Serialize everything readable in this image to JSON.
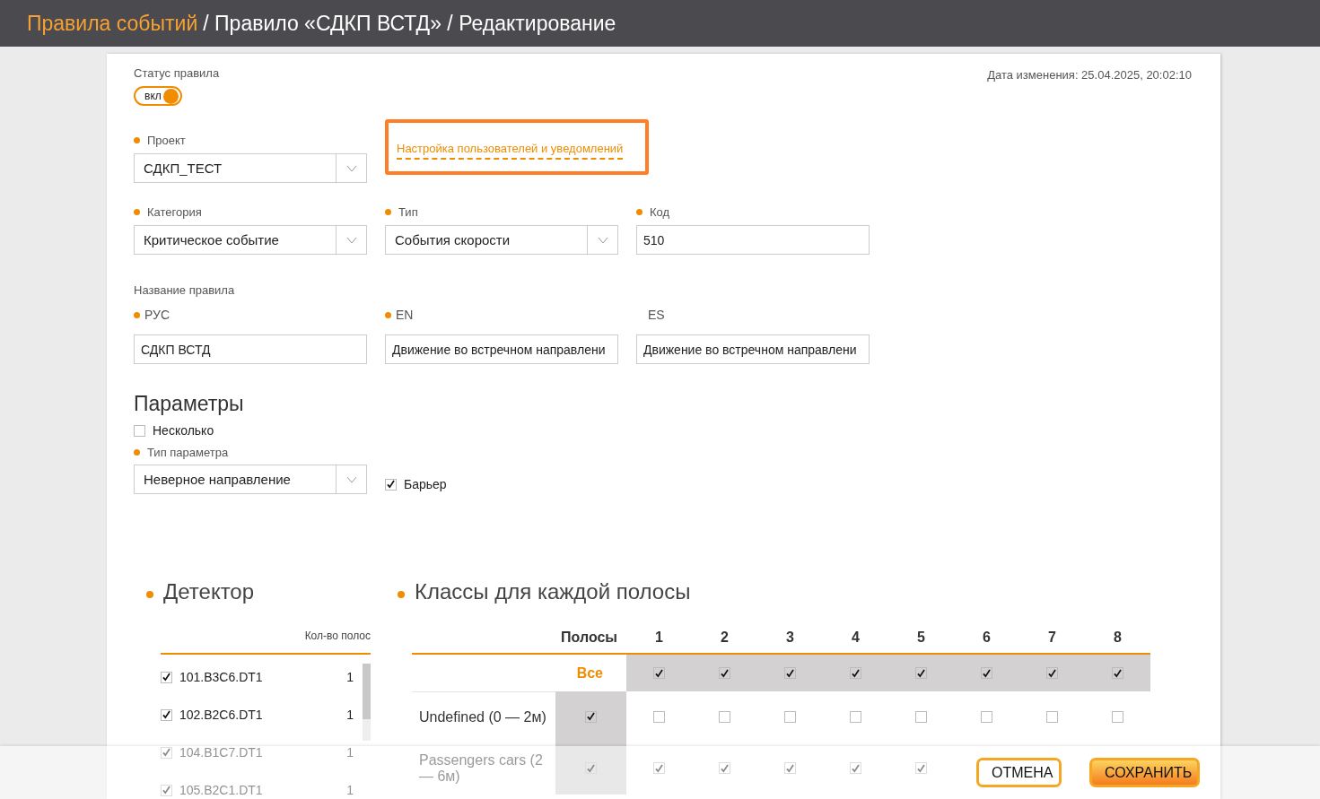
{
  "header": {
    "link": "Правила событий",
    "rest": "/ Правило «СДКП ВСТД» / Редактирование"
  },
  "status": {
    "label": "Статус правила",
    "toggle": {
      "text": "вкл",
      "on": true
    }
  },
  "modified": "Дата изменения: 25.04.2025, 20:02:10",
  "project": {
    "label": "Проект",
    "required": true,
    "value": "СДКП_ТЕСТ"
  },
  "notifications_link": "Настройка пользователей и уведомлений",
  "fields": [
    {
      "label": "Категория",
      "required": true,
      "kind": "select",
      "value": "Критическое событие"
    },
    {
      "label": "Тип",
      "required": true,
      "kind": "select",
      "value": "События скорости"
    },
    {
      "label": "Код",
      "required": true,
      "kind": "input",
      "value": "510"
    }
  ],
  "rule_name": {
    "label": "Название правила",
    "names": [
      {
        "label": "РУС",
        "required": true,
        "value": "СДКП ВСТД"
      },
      {
        "label": "EN",
        "required": true,
        "value": "Движение во встречном направлени"
      },
      {
        "label": "ES",
        "required": false,
        "value": "Движение во встречном направлени"
      }
    ]
  },
  "params": {
    "title": "Параметры",
    "multiple": {
      "label": "Несколько",
      "checked": false
    },
    "type": {
      "label": "Тип параметра",
      "required": true,
      "value": "Неверное направление"
    },
    "barrier": {
      "label": "Барьер",
      "checked": true
    }
  },
  "detector": {
    "title": "Детектор",
    "column": "Кол-во полос",
    "rows": [
      {
        "name": "101.B3C6.DT1",
        "lanes": "1",
        "checked": true
      },
      {
        "name": "102.B2C6.DT1",
        "lanes": "1",
        "checked": true
      },
      {
        "name": "104.B1C7.DT1",
        "lanes": "1",
        "checked": true
      },
      {
        "name": "105.B2C1.DT1",
        "lanes": "1",
        "checked": true
      }
    ]
  },
  "classes": {
    "title": "Классы для каждой полосы",
    "header": "Полосы",
    "lanes": [
      "1",
      "2",
      "3",
      "4",
      "5",
      "6",
      "7",
      "8"
    ],
    "all_row": {
      "label": "Все",
      "lanes": [
        true,
        true,
        true,
        true,
        true,
        true,
        true,
        true
      ]
    },
    "rows": [
      {
        "label": "Undefined (0 — 2м)",
        "all_checked": true,
        "lanes": [
          false,
          false,
          false,
          false,
          false,
          false,
          false,
          false
        ]
      },
      {
        "label": "Passengers cars (2 — 6м)",
        "all_checked": true,
        "lanes": [
          true,
          true,
          true,
          true,
          true
        ]
      }
    ]
  },
  "buttons": [
    {
      "label": "ОТМЕНА",
      "kind": "secondary"
    },
    {
      "label": "СОХРАНИТЬ",
      "kind": "primary"
    }
  ]
}
